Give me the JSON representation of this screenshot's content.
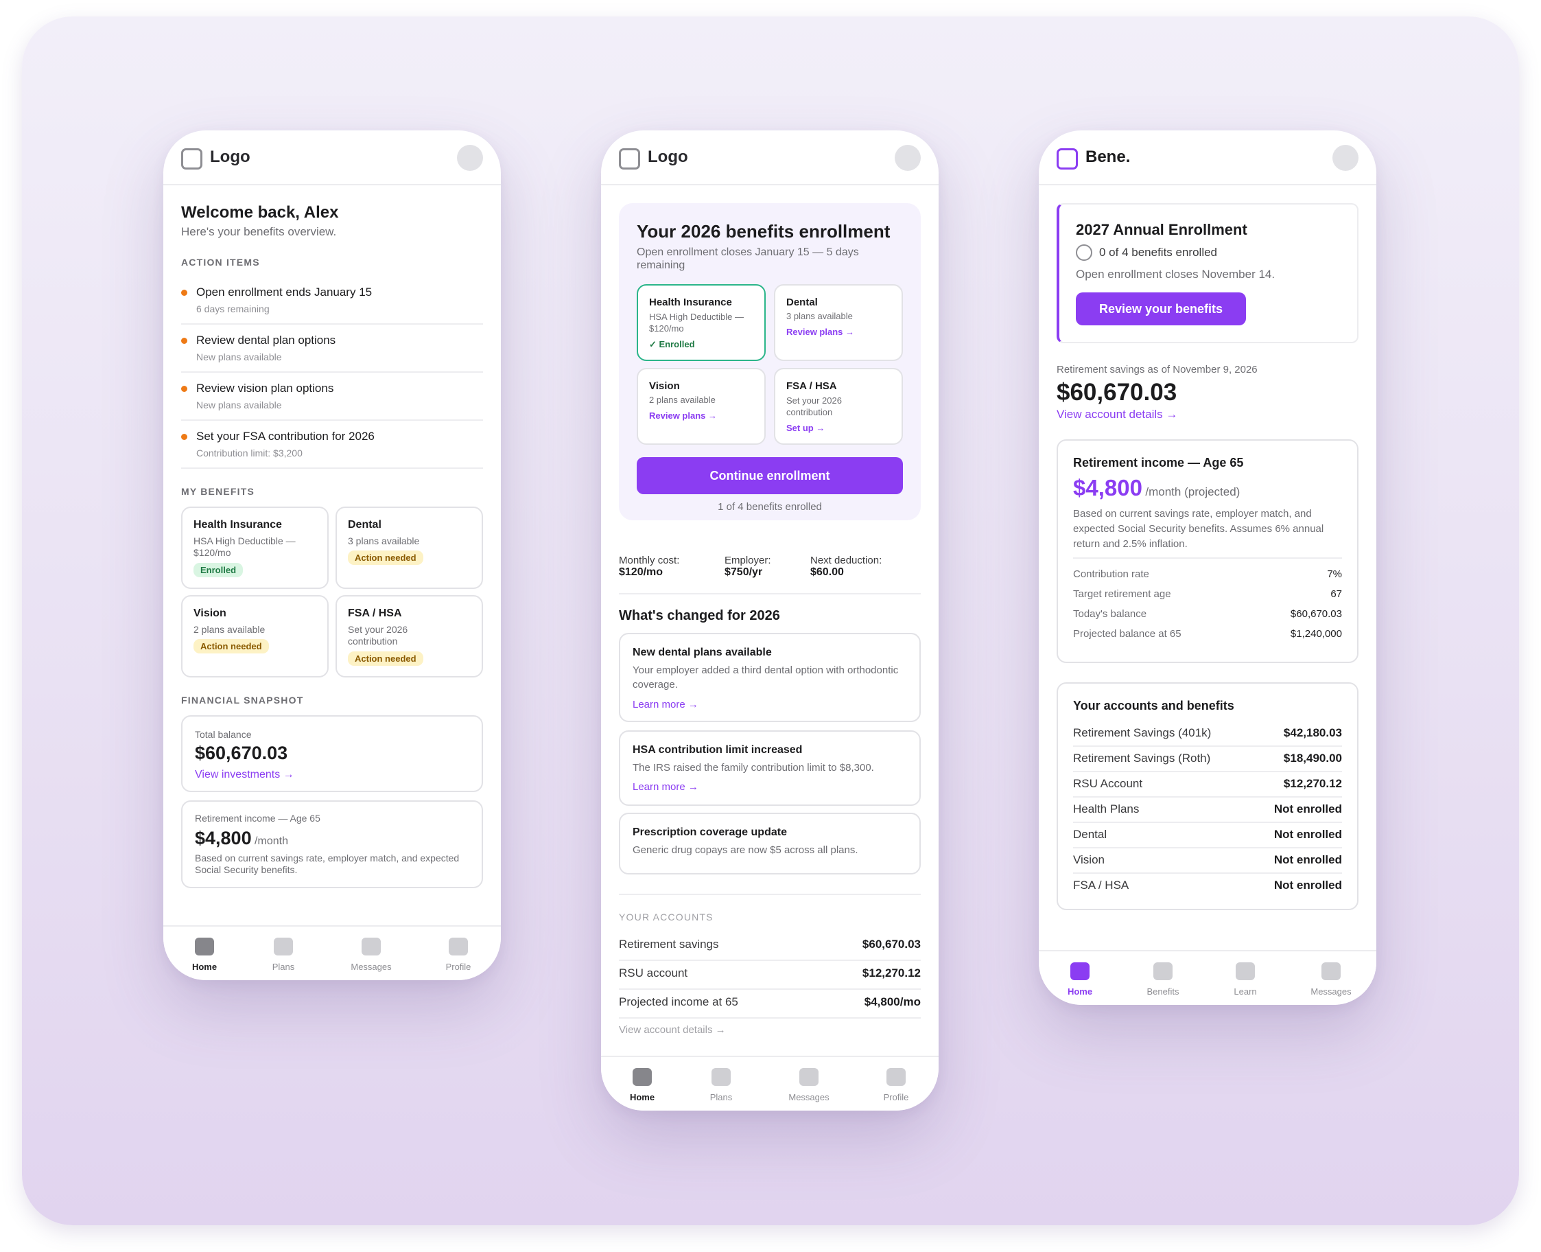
{
  "phone1": {
    "logo": "Logo",
    "welcome_title": "Welcome back, Alex",
    "welcome_sub": "Here's your benefits overview.",
    "action_items_label": "ACTION ITEMS",
    "action_items": [
      {
        "title": "Open enrollment ends January 15",
        "sub": "6 days remaining"
      },
      {
        "title": "Review dental plan options",
        "sub": "New plans available"
      },
      {
        "title": "Review vision plan options",
        "sub": "New plans available"
      },
      {
        "title": "Set your FSA contribution for 2026",
        "sub": "Contribution limit: $3,200"
      }
    ],
    "my_benefits_label": "MY BENEFITS",
    "benefits": [
      {
        "title": "Health Insurance",
        "sub": "HSA High Deductible — $120/mo",
        "badge": "Enrolled"
      },
      {
        "title": "Dental",
        "sub": "3 plans available",
        "badge": "Action needed"
      },
      {
        "title": "Vision",
        "sub": "2 plans available",
        "badge": "Action needed"
      },
      {
        "title": "FSA / HSA",
        "sub": "Set your 2026 contribution",
        "badge": "Action needed"
      }
    ],
    "snapshot_label": "FINANCIAL SNAPSHOT",
    "total_balance_label": "Total balance",
    "total_balance": "$60,670.03",
    "view_investments": "View investments →",
    "retirement_label": "Retirement income — Age 65",
    "retirement_value": "$4,800",
    "retirement_unit": "/month",
    "retirement_note": "Based on current savings rate, employer match, and expected Social Security benefits.",
    "nav": [
      "Home",
      "Plans",
      "Messages",
      "Profile"
    ]
  },
  "phone2": {
    "logo": "Logo",
    "hero_title": "Your 2026 benefits enrollment",
    "hero_sub": "Open enrollment closes January 15 — 5 days remaining",
    "tiles": [
      {
        "title": "Health Insurance",
        "sub": "HSA High Deductible — $120/mo",
        "link": "✓ Enrolled"
      },
      {
        "title": "Dental",
        "sub": "3 plans available",
        "link": "Review plans →"
      },
      {
        "title": "Vision",
        "sub": "2 plans available",
        "link": "Review plans →"
      },
      {
        "title": "FSA / HSA",
        "sub": "Set your 2026 contribution",
        "link": "Set up →"
      }
    ],
    "continue_button": "Continue enrollment",
    "progress_text": "1 of 4 benefits enrolled",
    "stats": [
      {
        "label": "Monthly cost:",
        "value": "$120/mo"
      },
      {
        "label": "Employer:",
        "value": "$750/yr"
      },
      {
        "label": "Next deduction:",
        "value": "$60.00"
      }
    ],
    "changes_title": "What's changed for 2026",
    "changes": [
      {
        "title": "New dental plans available",
        "body": "Your employer added a third dental option with orthodontic coverage.",
        "link": "Learn more →"
      },
      {
        "title": "HSA contribution limit increased",
        "body": "The IRS raised the family contribution limit to $8,300.",
        "link": "Learn more →"
      },
      {
        "title": "Prescription coverage update",
        "body": "Generic drug copays are now $5 across all plans.",
        "link": ""
      }
    ],
    "accounts_label": "YOUR ACCOUNTS",
    "accounts": [
      {
        "label": "Retirement savings",
        "value": "$60,670.03"
      },
      {
        "label": "RSU account",
        "value": "$12,270.12"
      },
      {
        "label": "Projected income at 65",
        "value": "$4,800/mo"
      }
    ],
    "view_details": "View account details →",
    "nav": [
      "Home",
      "Plans",
      "Messages",
      "Profile"
    ]
  },
  "phone3": {
    "logo": "Bene.",
    "enroll_title": "2027 Annual Enrollment",
    "enroll_progress": "0 of 4 benefits enrolled",
    "enroll_sub": "Open enrollment closes November 14.",
    "review_button": "Review your benefits",
    "savings_caption": "Retirement savings as of November 9, 2026",
    "savings_value": "$60,670.03",
    "view_account": "View account details →",
    "income_title": "Retirement income — Age 65",
    "income_value": "$4,800",
    "income_unit": "/month (projected)",
    "income_note": "Based on current savings rate, employer match, and expected Social Security benefits. Assumes 6% annual return and 2.5% inflation.",
    "income_rows": [
      {
        "label": "Contribution rate",
        "value": "7%"
      },
      {
        "label": "Target retirement age",
        "value": "67"
      },
      {
        "label": "Today's balance",
        "value": "$60,670.03"
      },
      {
        "label": "Projected balance at 65",
        "value": "$1,240,000"
      }
    ],
    "accounts_title": "Your accounts and benefits",
    "accounts": [
      {
        "label": "Retirement Savings (401k)",
        "value": "$42,180.03"
      },
      {
        "label": "Retirement Savings (Roth)",
        "value": "$18,490.00"
      },
      {
        "label": "RSU Account",
        "value": "$12,270.12"
      },
      {
        "label": "Health Plans",
        "value": "Not enrolled"
      },
      {
        "label": "Dental",
        "value": "Not enrolled"
      },
      {
        "label": "Vision",
        "value": "Not enrolled"
      },
      {
        "label": "FSA / HSA",
        "value": "Not enrolled"
      }
    ],
    "nav": [
      "Home",
      "Benefits",
      "Learn",
      "Messages"
    ]
  },
  "colors": {
    "accent": "#8b3df2",
    "warning_dot": "#ee7a16",
    "enrolled_green": "#1f7a44"
  }
}
